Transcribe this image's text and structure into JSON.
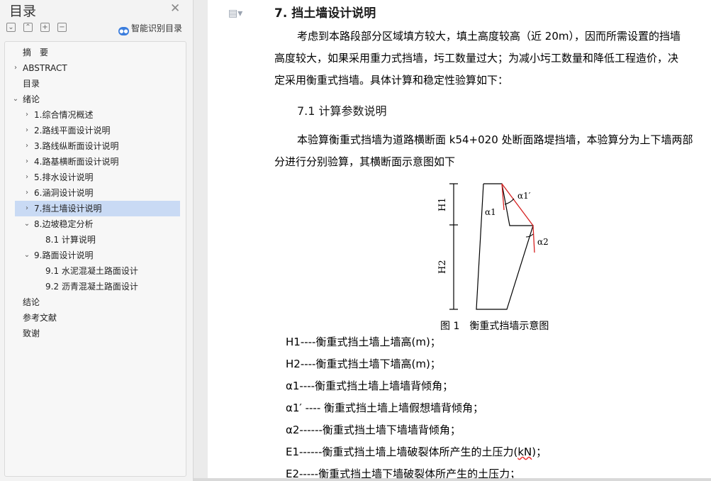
{
  "sidebar": {
    "title": "目录",
    "close_icon": "✕",
    "smart_toc_label": "智能识别目录",
    "items": [
      {
        "label": "摘　要",
        "has_arrow": false,
        "expanded": false,
        "level": 0
      },
      {
        "label": "ABSTRACT",
        "has_arrow": true,
        "expanded": false,
        "level": 0
      },
      {
        "label": "目录",
        "has_arrow": false,
        "expanded": false,
        "level": 0
      },
      {
        "label": "绪论",
        "has_arrow": true,
        "expanded": true,
        "level": 0
      },
      {
        "label": "1.综合情况概述",
        "has_arrow": true,
        "expanded": false,
        "level": 1
      },
      {
        "label": "2.路线平面设计说明",
        "has_arrow": true,
        "expanded": false,
        "level": 1
      },
      {
        "label": "3.路线纵断面设计说明",
        "has_arrow": true,
        "expanded": false,
        "level": 1
      },
      {
        "label": "4.路基横断面设计说明",
        "has_arrow": true,
        "expanded": false,
        "level": 1
      },
      {
        "label": "5.排水设计说明",
        "has_arrow": true,
        "expanded": false,
        "level": 1
      },
      {
        "label": "6.涵洞设计说明",
        "has_arrow": true,
        "expanded": false,
        "level": 1
      },
      {
        "label": "7.挡土墙设计说明",
        "has_arrow": true,
        "expanded": false,
        "level": 1,
        "selected": true
      },
      {
        "label": "8.边坡稳定分析",
        "has_arrow": true,
        "expanded": true,
        "level": 1
      },
      {
        "label": "8.1 计算说明",
        "has_arrow": false,
        "expanded": false,
        "level": 2
      },
      {
        "label": "9.路面设计说明",
        "has_arrow": true,
        "expanded": true,
        "level": 1
      },
      {
        "label": "9.1  水泥混凝土路面设计",
        "has_arrow": false,
        "expanded": false,
        "level": 2
      },
      {
        "label": "9.2  沥青混凝土路面设计",
        "has_arrow": false,
        "expanded": false,
        "level": 2
      },
      {
        "label": "结论",
        "has_arrow": false,
        "expanded": false,
        "level": 0
      },
      {
        "label": "参考文献",
        "has_arrow": false,
        "expanded": false,
        "level": 0
      },
      {
        "label": "致谢",
        "has_arrow": false,
        "expanded": false,
        "level": 0
      }
    ]
  },
  "doc": {
    "heading": "7. 挡土墙设计说明",
    "p1_lines": [
      "考虑到本路段部分区域填方较大，填土高度较高（近 20m），因而所需设置的挡墙",
      "高度较大，如果采用重力式挡墙，圬工数量过大；为减小圬工数量和降低工程造价，决",
      "定采用衡重式挡墙。具体计算和稳定性验算如下："
    ],
    "subheading": "7.1  计算参数说明",
    "p2_lines": [
      "本验算衡重式挡墙为道路横断面 k54+020 处断面路堤挡墙，本验算分为上下墙两部",
      "分进行分别验算，其横断面示意图如下"
    ],
    "figure": {
      "label_h1": "H1",
      "label_h2": "H2",
      "label_a1": "α1",
      "label_a1p": "α1′",
      "label_a2": "α2",
      "caption": "图 1　衡重式挡墙示意图"
    },
    "definitions": [
      "H1----衡重式挡土墙上墙高(m)；",
      "H2----衡重式挡土墙下墙高(m)；",
      "α1----衡重式挡土墙上墙墙背倾角；",
      "α1′ ----  衡重式挡土墙上墙假想墙背倾角；",
      "α2------衡重式挡土墙下墙墙背倾角；",
      "E1------衡重式挡土墙上墙破裂体所产生的土压力(",
      "E2-----衡重式挡土墙下墙破裂体所产生的土压力；"
    ],
    "e1_unit": "kN",
    "e1_tail": ")；"
  }
}
